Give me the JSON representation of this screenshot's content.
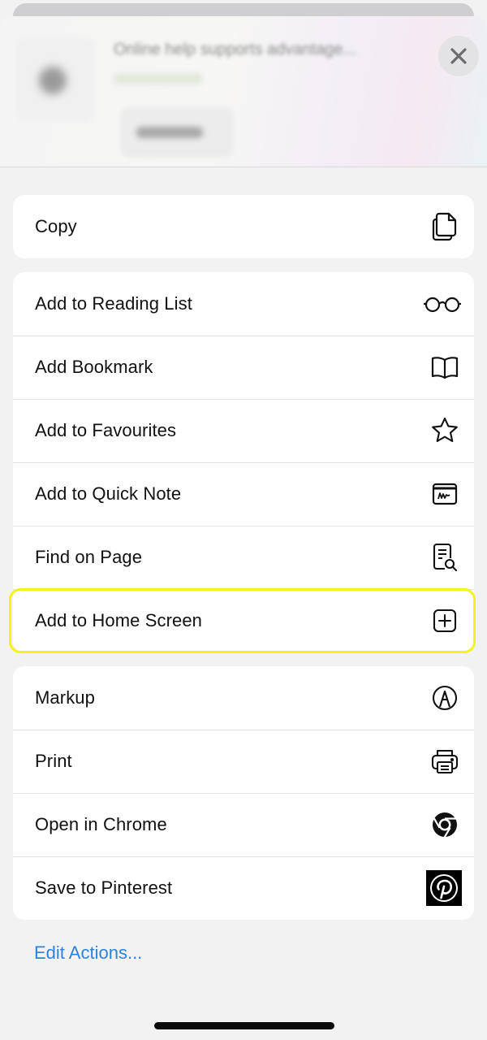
{
  "header": {
    "preview_title": "Online help supports advantage...",
    "close_icon": "close-icon"
  },
  "groups": [
    {
      "items": [
        {
          "label": "Copy",
          "icon": "copy-icon"
        }
      ]
    },
    {
      "items": [
        {
          "label": "Add to Reading List",
          "icon": "glasses-icon"
        },
        {
          "label": "Add Bookmark",
          "icon": "book-icon"
        },
        {
          "label": "Add to Favourites",
          "icon": "star-icon"
        },
        {
          "label": "Add to Quick Note",
          "icon": "quick-note-icon"
        },
        {
          "label": "Find on Page",
          "icon": "find-on-page-icon"
        },
        {
          "label": "Add to Home Screen",
          "icon": "plus-square-icon",
          "highlighted": true
        }
      ]
    },
    {
      "items": [
        {
          "label": "Markup",
          "icon": "markup-pen-icon"
        },
        {
          "label": "Print",
          "icon": "printer-icon"
        },
        {
          "label": "Open in Chrome",
          "icon": "chrome-icon"
        },
        {
          "label": "Save to Pinterest",
          "icon": "pinterest-icon"
        }
      ]
    }
  ],
  "footer": {
    "edit_actions": "Edit Actions..."
  },
  "colors": {
    "highlight": "#f3f31e",
    "link": "#2a83e0",
    "background": "#f2f2f2"
  }
}
